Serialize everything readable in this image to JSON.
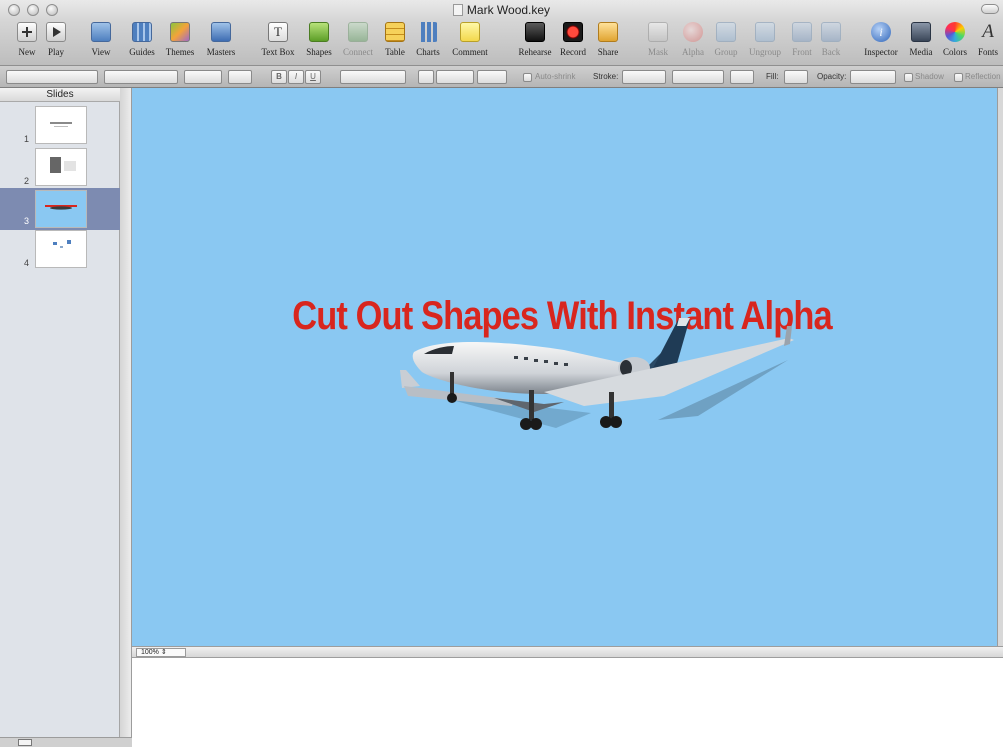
{
  "window": {
    "title": "Mark Wood.key"
  },
  "toolbar": {
    "items": [
      {
        "label": "New",
        "icon": "new-icon"
      },
      {
        "label": "Play",
        "icon": "play-icon"
      },
      {
        "label": "View",
        "icon": "view-icon"
      },
      {
        "label": "Guides",
        "icon": "guides-icon"
      },
      {
        "label": "Themes",
        "icon": "themes-icon"
      },
      {
        "label": "Masters",
        "icon": "masters-icon"
      },
      {
        "label": "Text Box",
        "icon": "text-box-icon"
      },
      {
        "label": "Shapes",
        "icon": "shapes-icon"
      },
      {
        "label": "Connect",
        "icon": "connect-icon",
        "enabled": false
      },
      {
        "label": "Table",
        "icon": "table-icon"
      },
      {
        "label": "Charts",
        "icon": "charts-icon"
      },
      {
        "label": "Comment",
        "icon": "comment-icon"
      },
      {
        "label": "Rehearse",
        "icon": "rehearse-icon"
      },
      {
        "label": "Record",
        "icon": "record-icon"
      },
      {
        "label": "Share",
        "icon": "share-icon"
      },
      {
        "label": "Mask",
        "icon": "mask-icon",
        "enabled": false
      },
      {
        "label": "Alpha",
        "icon": "alpha-icon",
        "enabled": false
      },
      {
        "label": "Group",
        "icon": "group-icon",
        "enabled": false
      },
      {
        "label": "Ungroup",
        "icon": "ungroup-icon",
        "enabled": false
      },
      {
        "label": "Front",
        "icon": "front-icon",
        "enabled": false
      },
      {
        "label": "Back",
        "icon": "back-icon",
        "enabled": false
      },
      {
        "label": "Inspector",
        "icon": "inspector-icon"
      },
      {
        "label": "Media",
        "icon": "media-icon"
      },
      {
        "label": "Colors",
        "icon": "colors-icon"
      },
      {
        "label": "Fonts",
        "icon": "fonts-icon"
      }
    ]
  },
  "format_bar": {
    "bold": "B",
    "italic": "I",
    "underline": "U",
    "auto_shrink": "Auto-shrink",
    "stroke_label": "Stroke:",
    "fill_label": "Fill:",
    "opacity_label": "Opacity:",
    "shadow_label": "Shadow",
    "reflection_label": "Reflection"
  },
  "navigator": {
    "header": "Slides",
    "slides": [
      {
        "number": "1",
        "selected": false
      },
      {
        "number": "2",
        "selected": false
      },
      {
        "number": "3",
        "selected": true
      },
      {
        "number": "4",
        "selected": false
      }
    ]
  },
  "slide": {
    "title": "Cut Out Shapes With Instant Alpha",
    "background": "#8ac8f2",
    "title_color": "#d8261e"
  },
  "zoom": {
    "value": "100%"
  },
  "colors": {
    "selection": "#7d8bb1",
    "accent": "#d8261e"
  }
}
